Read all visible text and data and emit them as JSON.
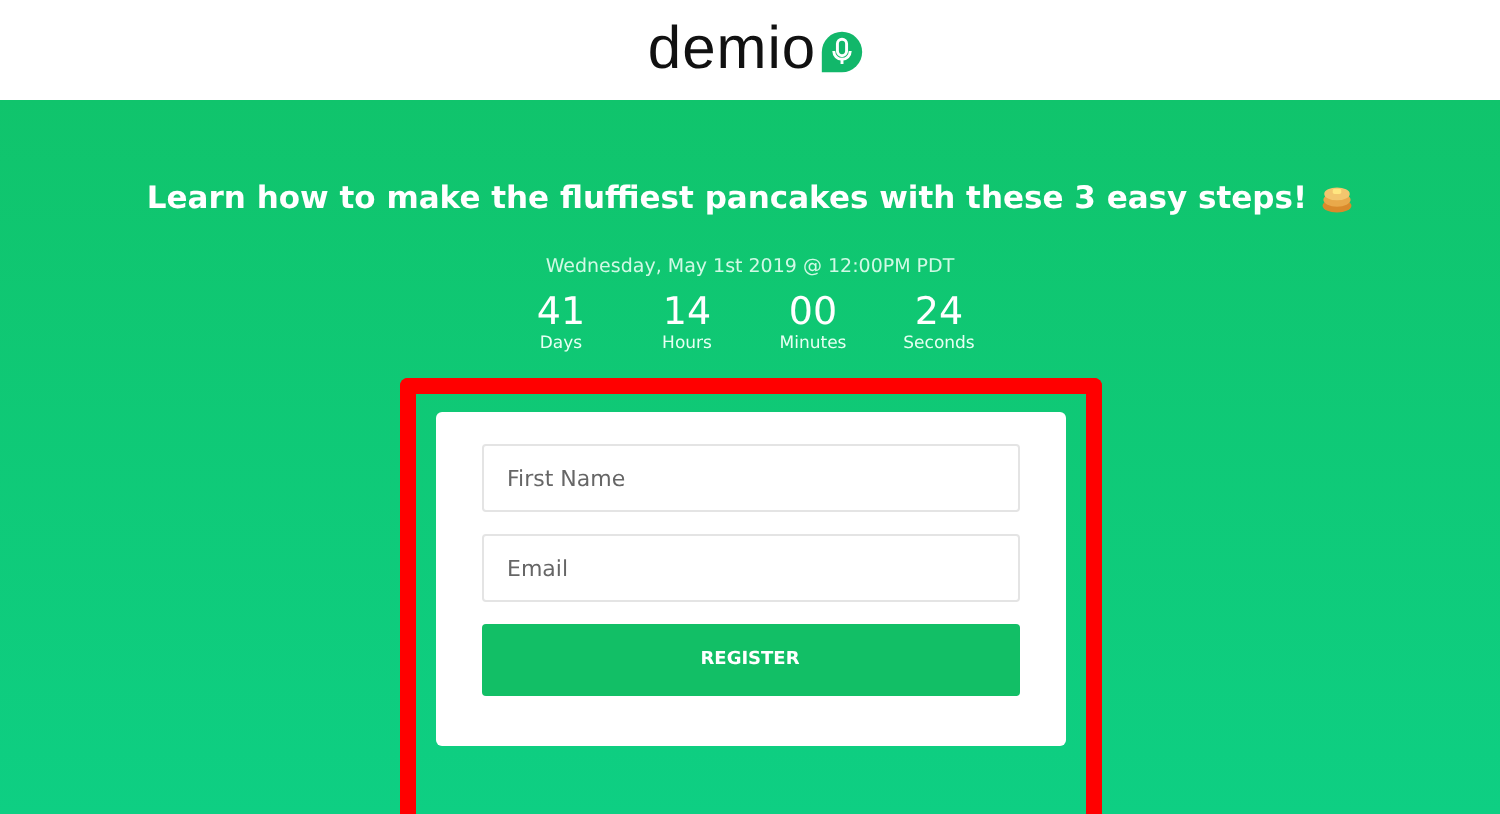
{
  "header": {
    "logo": "demio"
  },
  "event": {
    "title": "Learn how to make the fluffiest pancakes with these 3 easy steps!",
    "date": "Wednesday, May 1st 2019 @ 12:00PM PDT"
  },
  "countdown": [
    {
      "value": "41",
      "unit": "Days"
    },
    {
      "value": "14",
      "unit": "Hours"
    },
    {
      "value": "00",
      "unit": "Minutes"
    },
    {
      "value": "24",
      "unit": "Seconds"
    }
  ],
  "form": {
    "fields": [
      {
        "placeholder": "First Name"
      },
      {
        "placeholder": "Email"
      }
    ],
    "button": "REGISTER"
  }
}
